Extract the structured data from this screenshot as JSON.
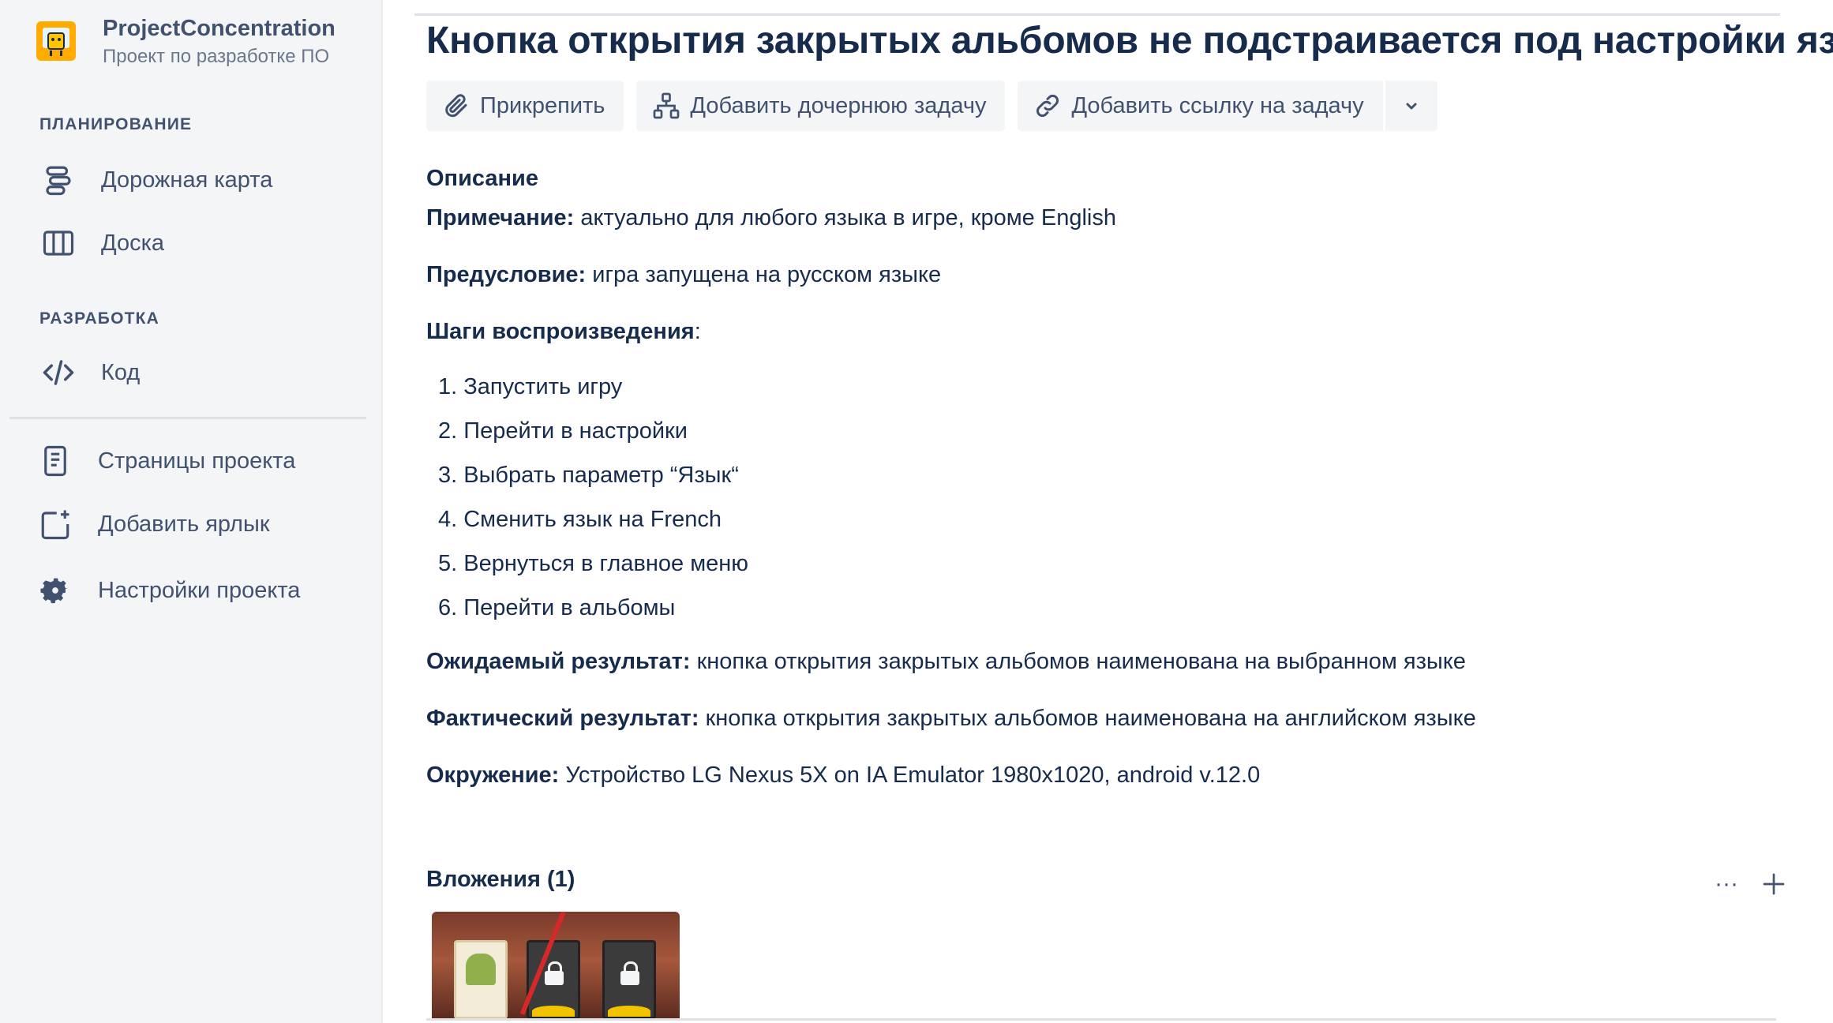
{
  "sidebar": {
    "project_name": "ProjectConcentration",
    "project_sub": "Проект по разработке ПО",
    "section_planning": "ПЛАНИРОВАНИЕ",
    "roadmap": "Дорожная карта",
    "board": "Доска",
    "section_dev": "РАЗРАБОТКА",
    "code": "Код",
    "pages": "Страницы проекта",
    "add_shortcut": "Добавить ярлык",
    "settings": "Настройки проекта"
  },
  "issue": {
    "title": "Кнопка открытия закрытых альбомов не подстраивается под настройки языка"
  },
  "toolbar": {
    "attach": "Прикрепить",
    "add_child": "Добавить дочернюю задачу",
    "add_link": "Добавить ссылку на задачу"
  },
  "description": {
    "heading": "Описание",
    "note_label": "Примечание:",
    "note_text": " актуально для любого языка в игре, кроме English",
    "precondition_label": "Предусловие:",
    "precondition_text": " игра запущена на русском языке",
    "steps_label": "Шаги воспроизведения",
    "steps_colon": ":",
    "steps": [
      "1. Запустить игру",
      "2. Перейти в настройки",
      "3. Выбрать параметр “Язык“",
      "4. Сменить язык на French",
      "5. Вернуться в главное меню",
      "6. Перейти в альбомы"
    ],
    "expected_label": "Ожидаемый результат:",
    "expected_text": " кнопка открытия закрытых альбомов наименована на выбранном языке",
    "actual_label": "Фактический результат:",
    "actual_text": " кнопка открытия закрытых альбомов наименована на английском языке",
    "env_label": "Окружение:",
    "env_text": " Устройство LG Nexus 5X on IA Emulator 1980x1020, android v.12.0"
  },
  "attachments": {
    "heading": "Вложения (1)",
    "more": "···"
  }
}
